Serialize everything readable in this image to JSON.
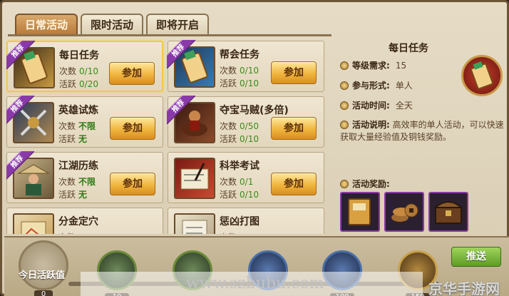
{
  "tabs": [
    {
      "label": "日常活动",
      "active": true
    },
    {
      "label": "限时活动",
      "active": false
    },
    {
      "label": "即将开启",
      "active": false
    }
  ],
  "labels": {
    "count": "次数",
    "active": "活跃",
    "join": "参加",
    "recommend": "推荐"
  },
  "activities": [
    {
      "title": "每日任务",
      "count": "0/10",
      "active": "0/20",
      "recommended": true,
      "selected": true
    },
    {
      "title": "帮会任务",
      "count": "0/10",
      "active": "0/10",
      "recommended": true,
      "selected": false
    },
    {
      "title": "英雄试炼",
      "count": "不限",
      "active": "无",
      "recommended": true,
      "selected": false
    },
    {
      "title": "夺宝马贼(多倍)",
      "count": "0/50",
      "active": "0/10",
      "recommended": true,
      "selected": false
    },
    {
      "title": "江湖历练",
      "count": "不限",
      "active": "无",
      "recommended": true,
      "selected": false
    },
    {
      "title": "科举考试",
      "count": "0/1",
      "active": "0/10",
      "recommended": false,
      "selected": false
    },
    {
      "title": "分金定穴",
      "count": "",
      "active": "",
      "recommended": false,
      "selected": false
    },
    {
      "title": "惩凶打图",
      "count": "",
      "active": "",
      "recommended": false,
      "selected": false
    }
  ],
  "detail": {
    "title": "每日任务",
    "level_key": "等级需求:",
    "level_val": "15",
    "mode_key": "参与形式:",
    "mode_val": "单人",
    "time_key": "活动时间:",
    "time_val": "全天",
    "desc_key": "活动说明:",
    "desc_val": "高效率的单人活动，可以快速获取大量经验值及铜钱奖励。",
    "reward_key": "活动奖励:",
    "rewards": [
      "exp-book-icon",
      "coins-icon",
      "treasure-chest-icon"
    ]
  },
  "bottom": {
    "today_label": "今日活跃值",
    "today_value": "0",
    "milestones": [
      "10",
      "",
      "",
      "100",
      "150"
    ],
    "push_label": "推送"
  },
  "watermark": "www.szbubu.com",
  "brand": "京华手游网"
}
